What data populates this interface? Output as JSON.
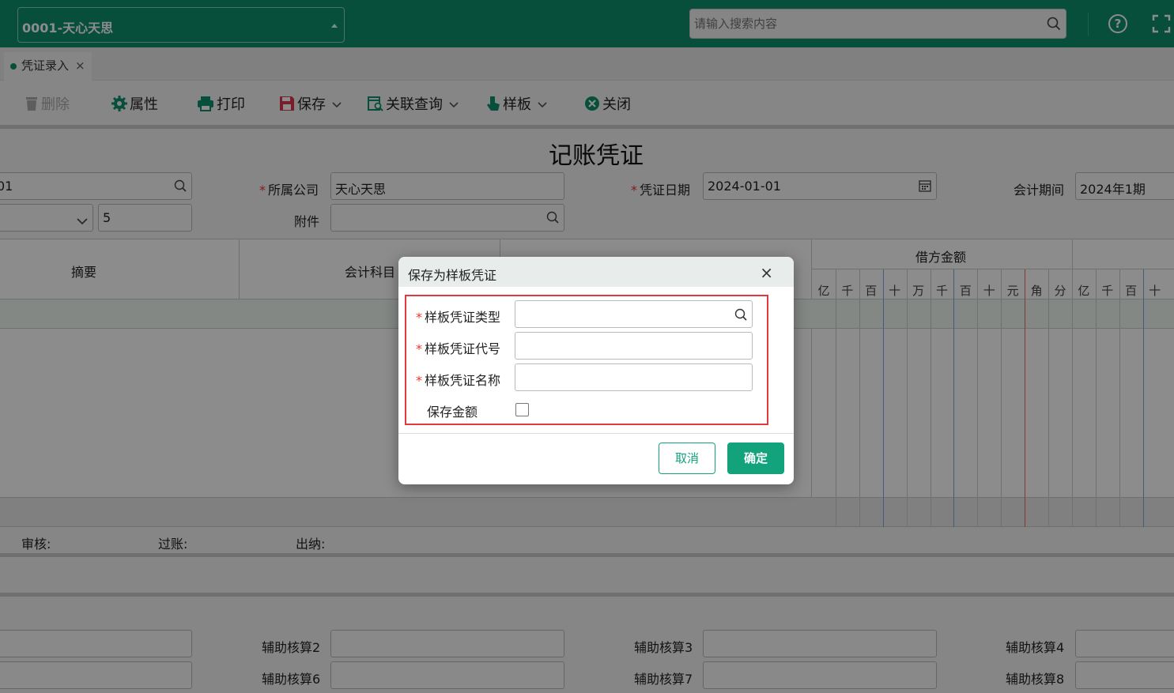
{
  "header": {
    "company": "0001-天心天思",
    "search_placeholder": "请输入搜索内容",
    "help_label": "?"
  },
  "tabs": [
    {
      "label": "凭证录入",
      "close": "×"
    }
  ],
  "toolbar": {
    "delete": "删除",
    "properties": "属性",
    "print": "打印",
    "save": "保存",
    "related_query": "关联查询",
    "template": "样板",
    "close": "关闭"
  },
  "form": {
    "title": "记账凭证",
    "voucher_no_partial": "01",
    "company_label": "所属公司",
    "company_value": "天心天思",
    "date_label": "凭证日期",
    "date_value": "2024-01-01",
    "period_label": "会计期间",
    "period_value": "2024年1期",
    "attach_label": "附件",
    "attach_count": "5",
    "required_mark": "*"
  },
  "grid": {
    "col_summary": "摘要",
    "col_account": "会计科目",
    "debit_header": "借方金额",
    "debit_digits": [
      "亿",
      "千",
      "百",
      "十",
      "万",
      "千",
      "百",
      "十",
      "元",
      "角",
      "分"
    ],
    "credit_digits": [
      "亿",
      "千",
      "百",
      "十"
    ]
  },
  "footer": {
    "review": "审核:",
    "post": "过账:",
    "cashier": "出纳:"
  },
  "aux": {
    "a2": "辅助核算2",
    "a3": "辅助核算3",
    "a4": "辅助核算4",
    "a6": "辅助核算6",
    "a7": "辅助核算7",
    "a8": "辅助核算8"
  },
  "dialog": {
    "title": "保存为样板凭证",
    "close": "×",
    "type_label": "样板凭证类型",
    "code_label": "样板凭证代号",
    "name_label": "样板凭证名称",
    "save_amount_label": "保存金额",
    "cancel": "取消",
    "ok": "确定",
    "required_mark": "*"
  }
}
